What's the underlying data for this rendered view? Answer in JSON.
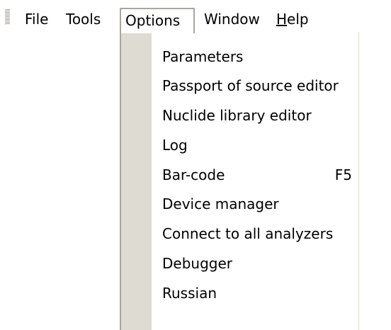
{
  "menubar": {
    "items": [
      {
        "label": "File"
      },
      {
        "label": "Tools"
      },
      {
        "label": "Options"
      },
      {
        "label": "Window"
      },
      {
        "label_accel": "H",
        "label_rest": "elp"
      }
    ]
  },
  "options_menu": {
    "items": [
      {
        "label": "Parameters",
        "shortcut": ""
      },
      {
        "label": "Passport of source editor",
        "shortcut": ""
      },
      {
        "label": "Nuclide library editor",
        "shortcut": ""
      },
      {
        "label": "Log",
        "shortcut": ""
      },
      {
        "label": "Bar-code",
        "shortcut": "F5"
      },
      {
        "label": "Device manager",
        "shortcut": ""
      },
      {
        "label": "Connect to all analyzers",
        "shortcut": ""
      },
      {
        "label": "Debugger",
        "shortcut": ""
      },
      {
        "label": "Russian",
        "shortcut": ""
      }
    ]
  },
  "colors": {
    "gutter": "#dedbd3",
    "border": "#a9a69d",
    "background": "#ffffff"
  }
}
